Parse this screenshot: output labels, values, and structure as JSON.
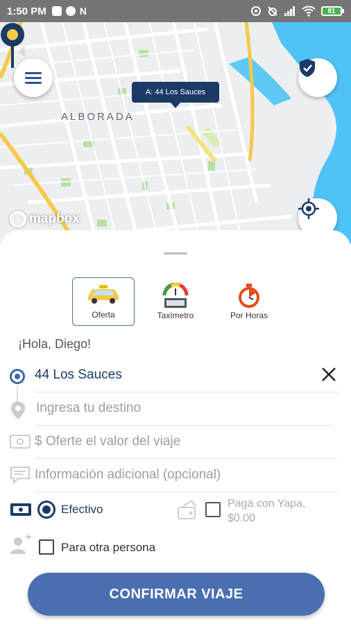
{
  "status_bar": {
    "time": "1:50 PM",
    "left_icons": [
      "photo-icon",
      "chrome-icon",
      "n-icon"
    ],
    "battery": "81"
  },
  "map": {
    "area_label": "ALBORADA",
    "attribution": "mapbox",
    "pin_tooltip": "A: 44 Los Sauces",
    "colors": {
      "water": "#4fc3f7",
      "road_main": "#f7c948",
      "park": "#b8e0a5",
      "pin": "#1b3a66",
      "pin_dot": "#f7c948"
    }
  },
  "modes": [
    {
      "label": "Oferta",
      "icon": "taxi-icon",
      "active": true
    },
    {
      "label": "Taxímetro",
      "icon": "taximeter-icon",
      "active": false
    },
    {
      "label": "Por Horas",
      "icon": "stopwatch-icon",
      "active": false
    }
  ],
  "greeting": "¡Hola, Diego!",
  "form": {
    "origin_value": "44 Los Sauces",
    "destination_placeholder": "Ingresa tu destino",
    "offer_placeholder": "$ Oferte el valor del viaje",
    "info_placeholder": "Información adicional (opcional)"
  },
  "payment": {
    "cash_label": "Efectivo",
    "cash_selected": true,
    "yapa_label_line1": "Paga con Yapa,",
    "yapa_label_line2": "$0.00",
    "yapa_checked": false
  },
  "other_person": {
    "label": "Para otra persona",
    "checked": false
  },
  "confirm_label": "CONFIRMAR VIAJE",
  "colors": {
    "accent": "#4a6fb0",
    "dark_blue": "#1b3a66",
    "placeholder": "#9e9e9e"
  }
}
